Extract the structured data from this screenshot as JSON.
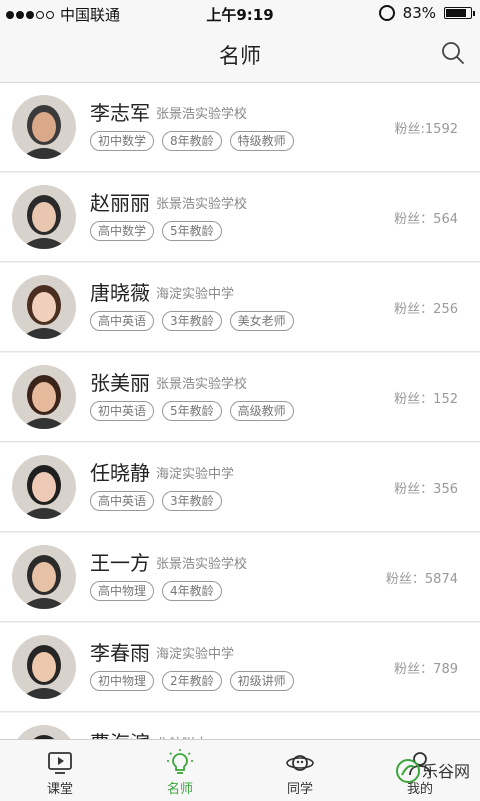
{
  "status": {
    "carrier": "中国联通",
    "time": "上午9:19",
    "battery": "83%",
    "battery_level": 0.83
  },
  "header": {
    "title": "名师"
  },
  "teachers": [
    {
      "name": "李志军",
      "school": "张景浩实验学校",
      "tags": [
        "初中数学",
        "8年教龄",
        "特级教师"
      ],
      "fans": "粉丝:1592"
    },
    {
      "name": "赵丽丽",
      "school": "张景浩实验学校",
      "tags": [
        "高中数学",
        "5年教龄"
      ],
      "fans": "粉丝：564"
    },
    {
      "name": "唐晓薇",
      "school": "海淀实验中学",
      "tags": [
        "高中英语",
        "3年教龄",
        "美女老师"
      ],
      "fans": "粉丝：256"
    },
    {
      "name": "张美丽",
      "school": "张景浩实验学校",
      "tags": [
        "初中英语",
        "5年教龄",
        "高级教师"
      ],
      "fans": "粉丝：152"
    },
    {
      "name": "任晓静",
      "school": "海淀实验中学",
      "tags": [
        "高中英语",
        "3年教龄"
      ],
      "fans": "粉丝：356"
    },
    {
      "name": "王一方",
      "school": "张景浩实验学校",
      "tags": [
        "高中物理",
        "4年教龄"
      ],
      "fans": "粉丝：5874"
    },
    {
      "name": "李春雨",
      "school": "海淀实验中学",
      "tags": [
        "初中物理",
        "2年教龄",
        "初级讲师"
      ],
      "fans": "粉丝：789"
    },
    {
      "name": "曹海滨",
      "school": "北航附中",
      "tags": [],
      "fans": ""
    }
  ],
  "tabs": [
    {
      "label": "课堂",
      "icon": "classroom-icon"
    },
    {
      "label": "名师",
      "icon": "lightbulb-icon"
    },
    {
      "label": "同学",
      "icon": "planet-icon"
    },
    {
      "label": "我的",
      "icon": "person-icon"
    }
  ],
  "watermark": "乐谷网",
  "colors": {
    "accent": "#3ba53b",
    "background": "#f2f2f2",
    "bar": "#f7f7f7"
  }
}
